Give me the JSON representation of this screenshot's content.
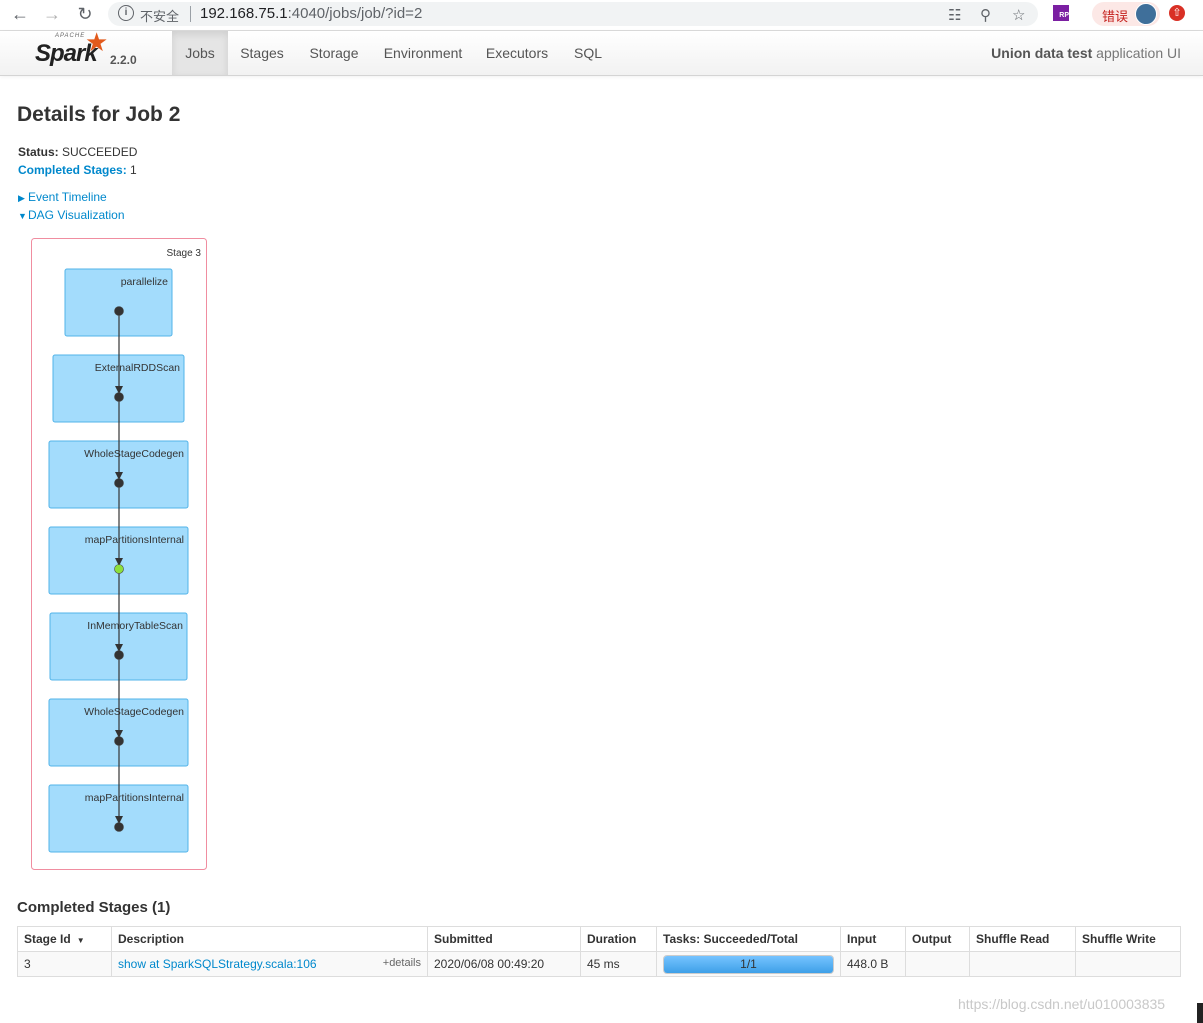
{
  "browser": {
    "insecure_label": "不安全",
    "url_host": "192.168.75.1",
    "url_path": ":4040/jobs/job/?id=2",
    "error_label": "错误"
  },
  "navbar": {
    "logo_apache": "APACHE",
    "logo_spark": "Spark",
    "version": "2.2.0",
    "tabs": [
      {
        "label": "Jobs"
      },
      {
        "label": "Stages"
      },
      {
        "label": "Storage"
      },
      {
        "label": "Environment"
      },
      {
        "label": "Executors"
      },
      {
        "label": "SQL"
      }
    ],
    "app_name": "Union data test",
    "app_suffix": " application UI"
  },
  "job": {
    "title": "Details for Job 2",
    "status_label": "Status:",
    "status_value": "SUCCEEDED",
    "completed_label": "Completed Stages:",
    "completed_value": "1",
    "event_timeline": "Event Timeline",
    "dag_visualization": "DAG Visualization"
  },
  "dag": {
    "stage_label": "Stage 3",
    "nodes": [
      {
        "label": "parallelize",
        "dot": "dark"
      },
      {
        "label": "ExternalRDDScan",
        "dot": "dark"
      },
      {
        "label": "WholeStageCodegen",
        "dot": "dark"
      },
      {
        "label": "mapPartitionsInternal",
        "dot": "green"
      },
      {
        "label": "InMemoryTableScan",
        "dot": "dark"
      },
      {
        "label": "WholeStageCodegen",
        "dot": "dark"
      },
      {
        "label": "mapPartitionsInternal",
        "dot": "dark"
      }
    ],
    "colors": {
      "node_fill": "#a3dcfc",
      "node_stroke": "#52b3e8",
      "stage_border": "#f08da0",
      "dot_dark": "#333333",
      "dot_green": "#8cdf3b"
    }
  },
  "completed_stages": {
    "title": "Completed Stages (1)",
    "headers": [
      "Stage Id",
      "Description",
      "Submitted",
      "Duration",
      "Tasks: Succeeded/Total",
      "Input",
      "Output",
      "Shuffle Read",
      "Shuffle Write"
    ],
    "rows": [
      {
        "stage_id": "3",
        "description": "show at SparkSQLStrategy.scala:106",
        "details": "+details",
        "submitted": "2020/06/08 00:49:20",
        "duration": "45 ms",
        "tasks": "1/1",
        "tasks_fraction": 1.0,
        "input": "448.0 B",
        "output": "",
        "shuffle_read": "",
        "shuffle_write": ""
      }
    ]
  },
  "watermark": "https://blog.csdn.net/u010003835"
}
